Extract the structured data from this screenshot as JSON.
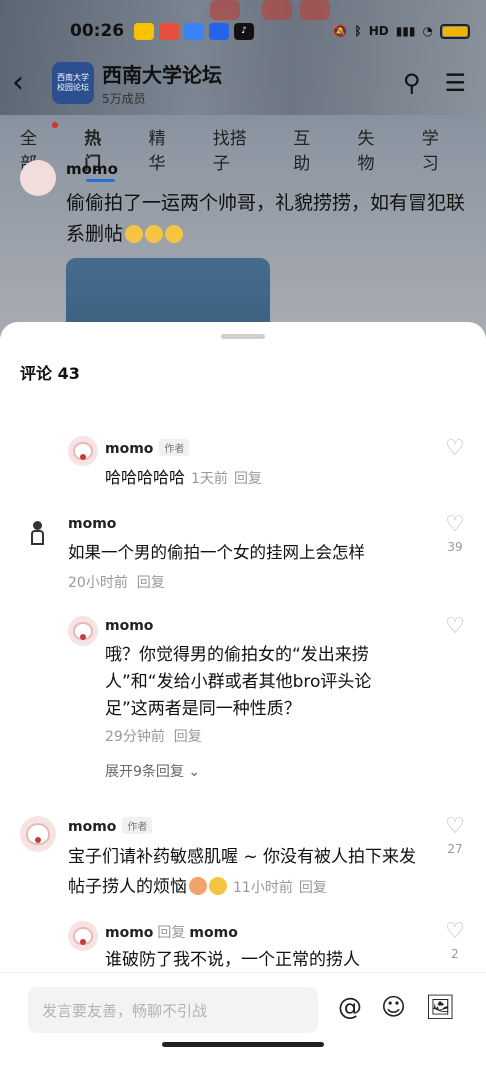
{
  "status": {
    "time": "00:26",
    "apps": [
      {
        "icon": "meituan-icon",
        "color": "#f7c200"
      },
      {
        "icon": "app-red-icon",
        "color": "#e84e3c"
      },
      {
        "icon": "app-blue-icon",
        "color": "#3b82f6"
      },
      {
        "icon": "app-navy-icon",
        "color": "#2563eb"
      },
      {
        "icon": "tiktok-icon",
        "color": "#111111"
      }
    ],
    "right_icons": [
      "mute-icon",
      "bluetooth-icon",
      "hd-icon",
      "signal-icon",
      "wifi-icon",
      "battery-icon"
    ],
    "hd": "HD"
  },
  "forum": {
    "title": "西南大学论坛",
    "members": "5万成员",
    "logo_lines": [
      "西南大学",
      "校园论坛"
    ]
  },
  "tabs": [
    "全部",
    "热门",
    "精华",
    "找搭子",
    "互助",
    "失物",
    "学习"
  ],
  "active_tab": "热门",
  "post": {
    "author": "momo",
    "text": "偷偷拍了一运两个帅哥，礼貌捞捞，如有冒犯联系删帖"
  },
  "sheet": {
    "title": "评论 43",
    "comments": [
      {
        "author": "momo",
        "badge": "作者",
        "text": "哈哈哈哈哈",
        "time": "1天前",
        "reply": "回复"
      },
      {
        "author": "momo",
        "text": "如果一个男的偷拍一个女的挂网上会怎样",
        "time": "20小时前",
        "reply": "回复",
        "likes": "39"
      },
      {
        "author": "momo",
        "text": "哦？你觉得男的偷拍女的“发出来捞人”和“发给小群或者其他bro评头论足”这两者是同一种性质？",
        "time": "29分钟前",
        "reply": "回复",
        "expand": "展开9条回复"
      },
      {
        "author": "momo",
        "badge": "作者",
        "text": "宝子们请补药敏感肌喔 ~ 你没有被人拍下来发帖子捞人的烦恼",
        "time": "11小时前",
        "reply": "回复",
        "likes": "27"
      },
      {
        "author": "momo",
        "reply_label": "回复",
        "reply_to": "momo",
        "text": "谁破防了我不说，一个正常的捞人",
        "likes": "2"
      }
    ]
  },
  "input": {
    "placeholder": "发言要友善，畅聊不引战"
  },
  "colors": {
    "accent": "#2b6fd6",
    "sheet_bg": "#ffffff",
    "meta": "#999999"
  }
}
